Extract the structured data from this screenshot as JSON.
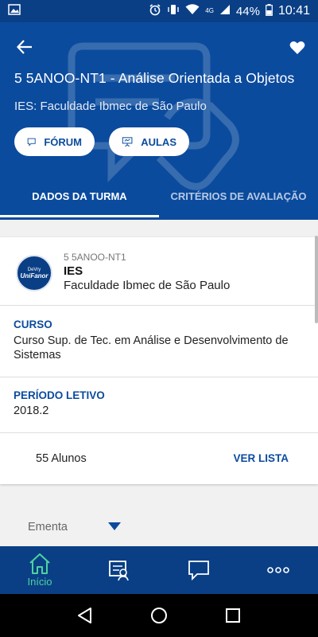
{
  "status_bar": {
    "time": "10:41",
    "battery": "44%",
    "network_label": "4G"
  },
  "header": {
    "course_title": "5 5ANOO-NT1 - Análise Orientada a Objetos",
    "ies_line": "IES: Faculdade Ibmec de São Paulo",
    "buttons": {
      "forum": "FÓRUM",
      "aulas": "AULAS"
    },
    "tabs": [
      "DADOS DA TURMA",
      "CRITÉRIOS DE AVALIAÇÃO"
    ]
  },
  "institution": {
    "code": "5 5ANOO-NT1",
    "label": "IES",
    "name": "Faculdade Ibmec de São Paulo",
    "logo_text_top": "DeVry",
    "logo_text_bottom": "UniFanor"
  },
  "curso": {
    "label": "CURSO",
    "value": "Curso Sup. de Tec. em Análise e Desenvolvimento de Sistemas"
  },
  "periodo": {
    "label": "PERÍODO LETIVO",
    "value": "2018.2"
  },
  "alunos": {
    "count_text": "55 Alunos",
    "action": "VER LISTA"
  },
  "ementa": {
    "label": "Ementa"
  },
  "bottom_nav": {
    "items": [
      {
        "label": "Início",
        "icon": "home-icon"
      },
      {
        "label": "",
        "icon": "classes-icon"
      },
      {
        "label": "",
        "icon": "chat-icon"
      },
      {
        "label": "",
        "icon": "more-icon"
      }
    ]
  },
  "colors": {
    "primary": "#0b4b9e",
    "nav_active": "#4dd39e"
  }
}
